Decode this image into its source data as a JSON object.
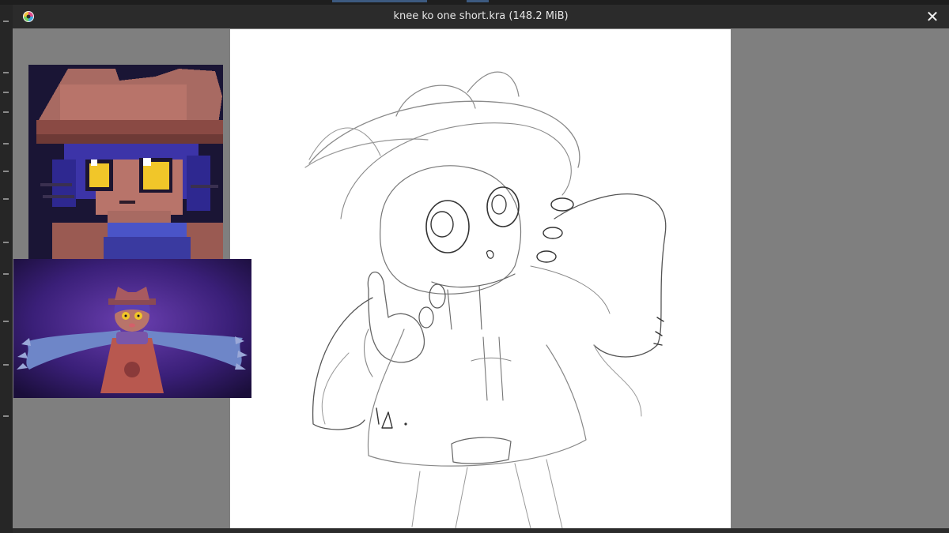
{
  "window": {
    "title": "knee ko one short.kra (148.2 MiB)",
    "close_label": "✕"
  },
  "icons": {
    "app": "krita-logo-icon",
    "close": "close-icon"
  },
  "colors": {
    "chrome": "#2b2b2b",
    "workspace": "#7f7f7f",
    "canvas": "#ffffff",
    "sketch_stroke": "#555555"
  },
  "references": [
    {
      "name": "pixel-art-reference",
      "subject": "cat character portrait, pixel art"
    },
    {
      "name": "full-body-reference",
      "subject": "cat character with scarf on purple background"
    }
  ]
}
